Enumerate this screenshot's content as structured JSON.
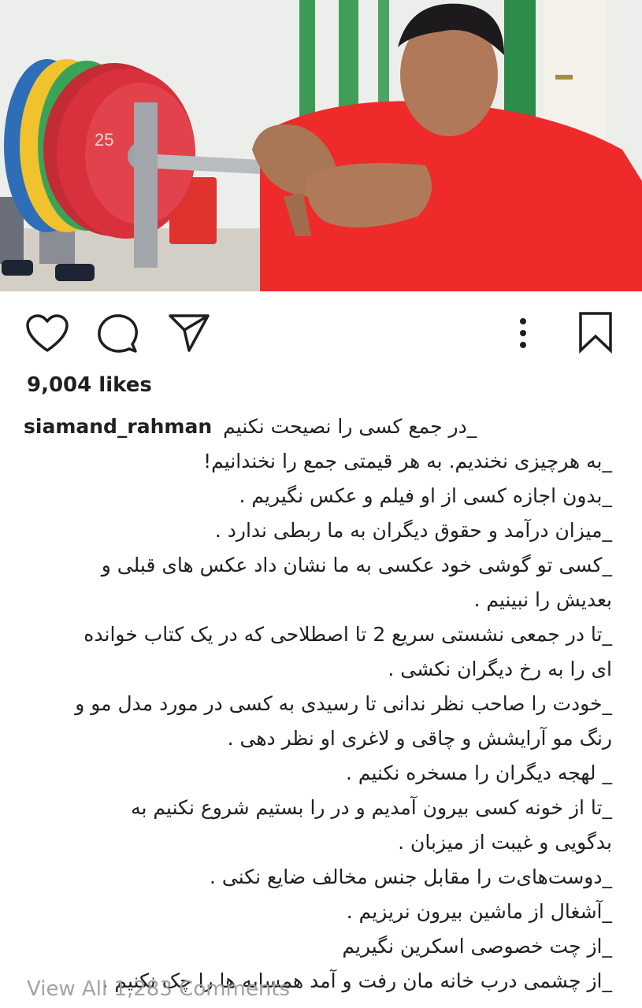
{
  "post": {
    "username": "siamand_rahman",
    "likes": "9,004 likes",
    "caption_first": "_در جمع کسی را نصیحت نکنیم",
    "caption_lines": [
      "_به هرچیزی نخندیم. به هر قیمتی جمع را نخندانیم!",
      "_بدون اجازه کسی از او فیلم و عکس نگیریم .",
      "_میزان درآمد و حقوق دیگران به ما ربطی ندارد .",
      "_کسی تو گوشی خود عکسی به ما نشان داد عکس های قبلی و",
      "بعدیش را نبینیم .",
      "_تا در جمعی نشستی سریع 2 تا اصطلاحی که در یک کتاب خوانده",
      "ای را به رخ دیگران نکشی .",
      "_خودت را صاحب نظر ندانی تا رسیدی به کسی در مورد مدل مو و",
      "رنگ مو آرایشش و چاقی و لاغری او نظر دهی .",
      "_ لهجه دیگران را مسخره نکنیم .",
      "_تا از خونه کسی بیرون آمدیم و در را بستیم شروع نکنیم به",
      "بدگویی و غیبت از میزبان .",
      "_دوست‌های‌ت را مقابل جنس مخالف ضایع نکنی .",
      "_آشغال از ماشین بیرون نریزیم .",
      "_از چت خصوصی اسکرین نگیریم",
      "_از چشمی درب خانه مان رفت و آمد همسایه ها را چک نکنیم ."
    ],
    "view_comments": "View All 1,283 Comments"
  },
  "actions": {
    "like": "heart-icon",
    "comment": "comment-icon",
    "share": "send-icon",
    "more": "more-vertical-icon",
    "save": "bookmark-icon"
  },
  "colors": {
    "text": "#1e1e1e",
    "muted": "#a2a2a2",
    "shirt": "#ee2a2a",
    "plate_red": "#d9313c"
  }
}
